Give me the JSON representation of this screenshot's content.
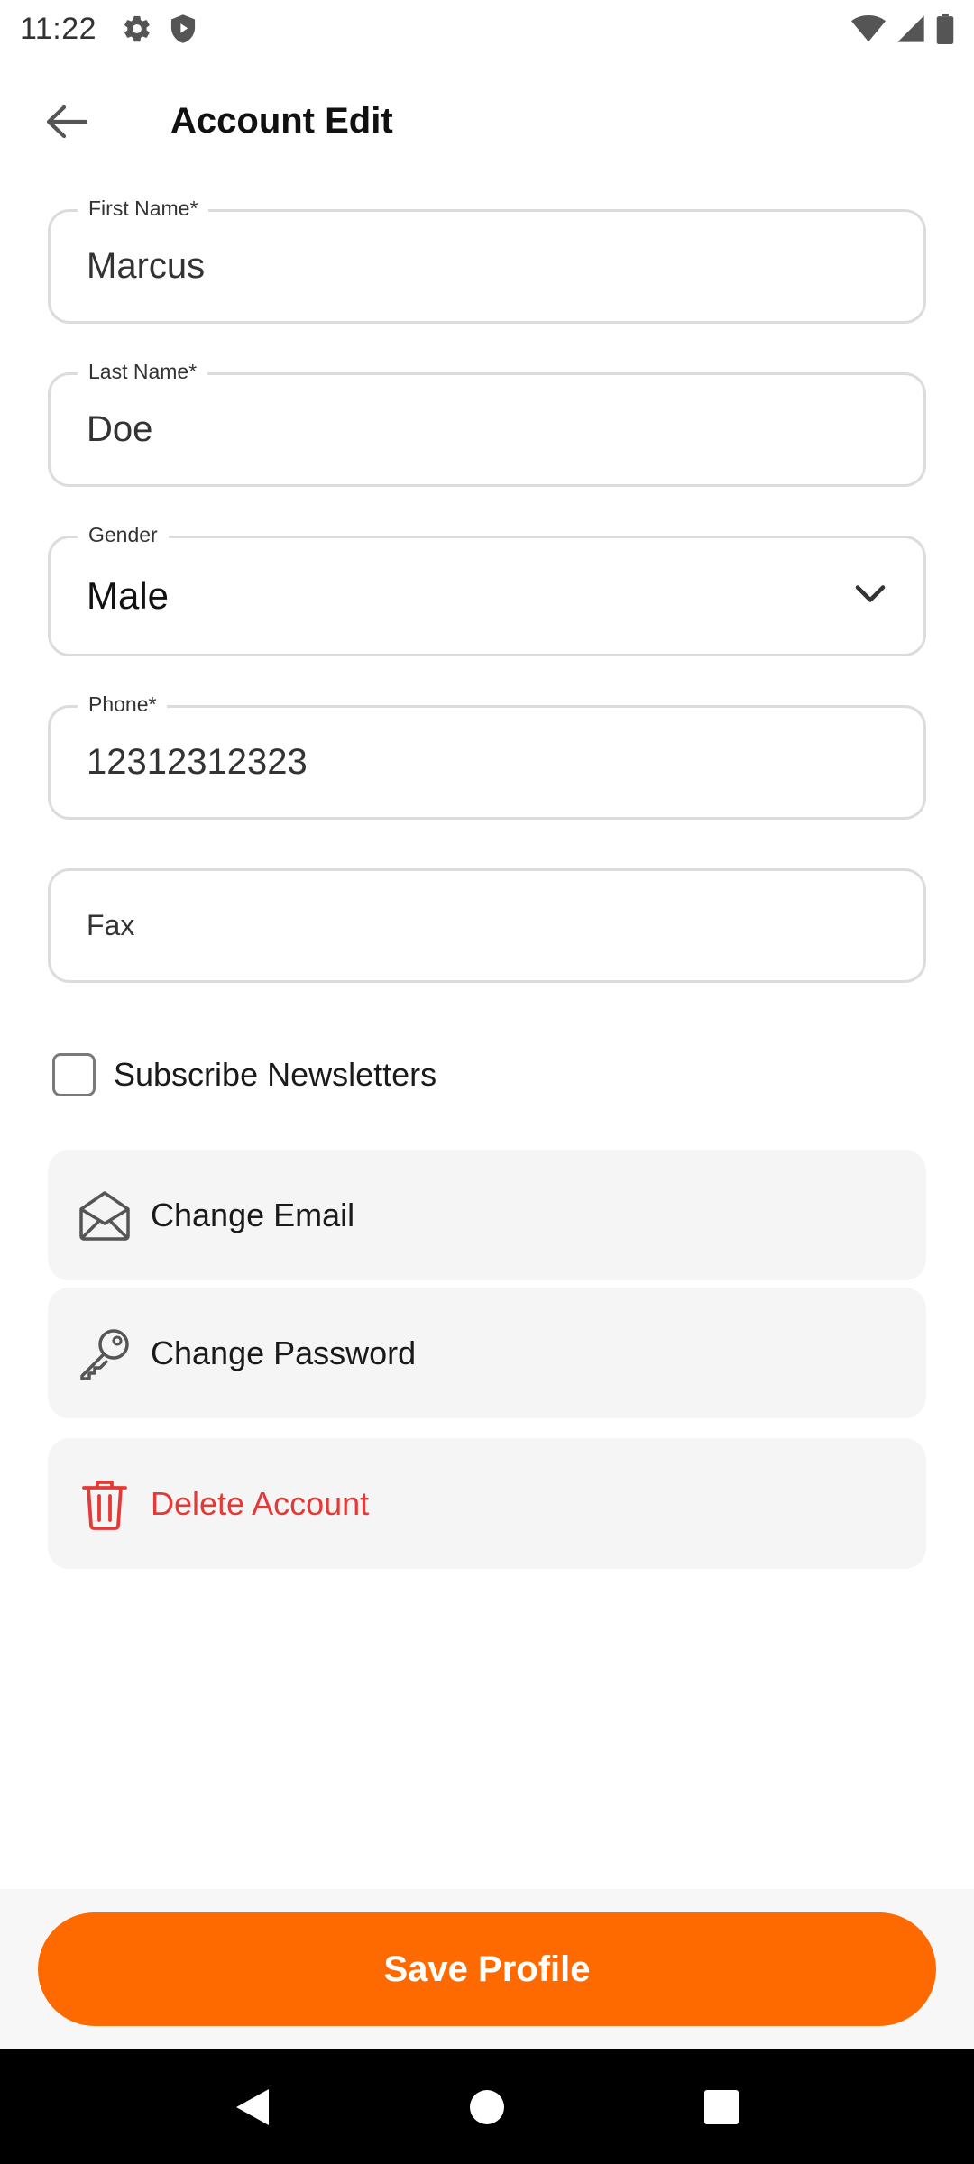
{
  "status_bar": {
    "time": "11:22",
    "icons": [
      "gear-icon",
      "shield-icon",
      "wifi-icon",
      "signal-icon",
      "battery-icon"
    ]
  },
  "app_bar": {
    "title": "Account Edit"
  },
  "form": {
    "first_name": {
      "label": "First Name*",
      "value": "Marcus"
    },
    "last_name": {
      "label": "Last Name*",
      "value": "Doe"
    },
    "gender": {
      "label": "Gender",
      "value": "Male"
    },
    "phone": {
      "label": "Phone*",
      "value": "12312312323"
    },
    "fax": {
      "placeholder": "Fax"
    }
  },
  "newsletter": {
    "label": "Subscribe Newsletters",
    "checked": false
  },
  "actions": [
    {
      "label": "Change Email",
      "icon": "envelope-open-icon"
    },
    {
      "label": "Change Password",
      "icon": "key-icon"
    },
    {
      "label": "Delete Account",
      "icon": "trash-icon",
      "color": "#e53935"
    }
  ],
  "footer": {
    "save_label": "Save Profile",
    "accent_color": "#ff6a00"
  },
  "nav_bar": {
    "buttons": [
      "back-triangle-icon",
      "home-circle-icon",
      "recents-square-icon"
    ]
  }
}
